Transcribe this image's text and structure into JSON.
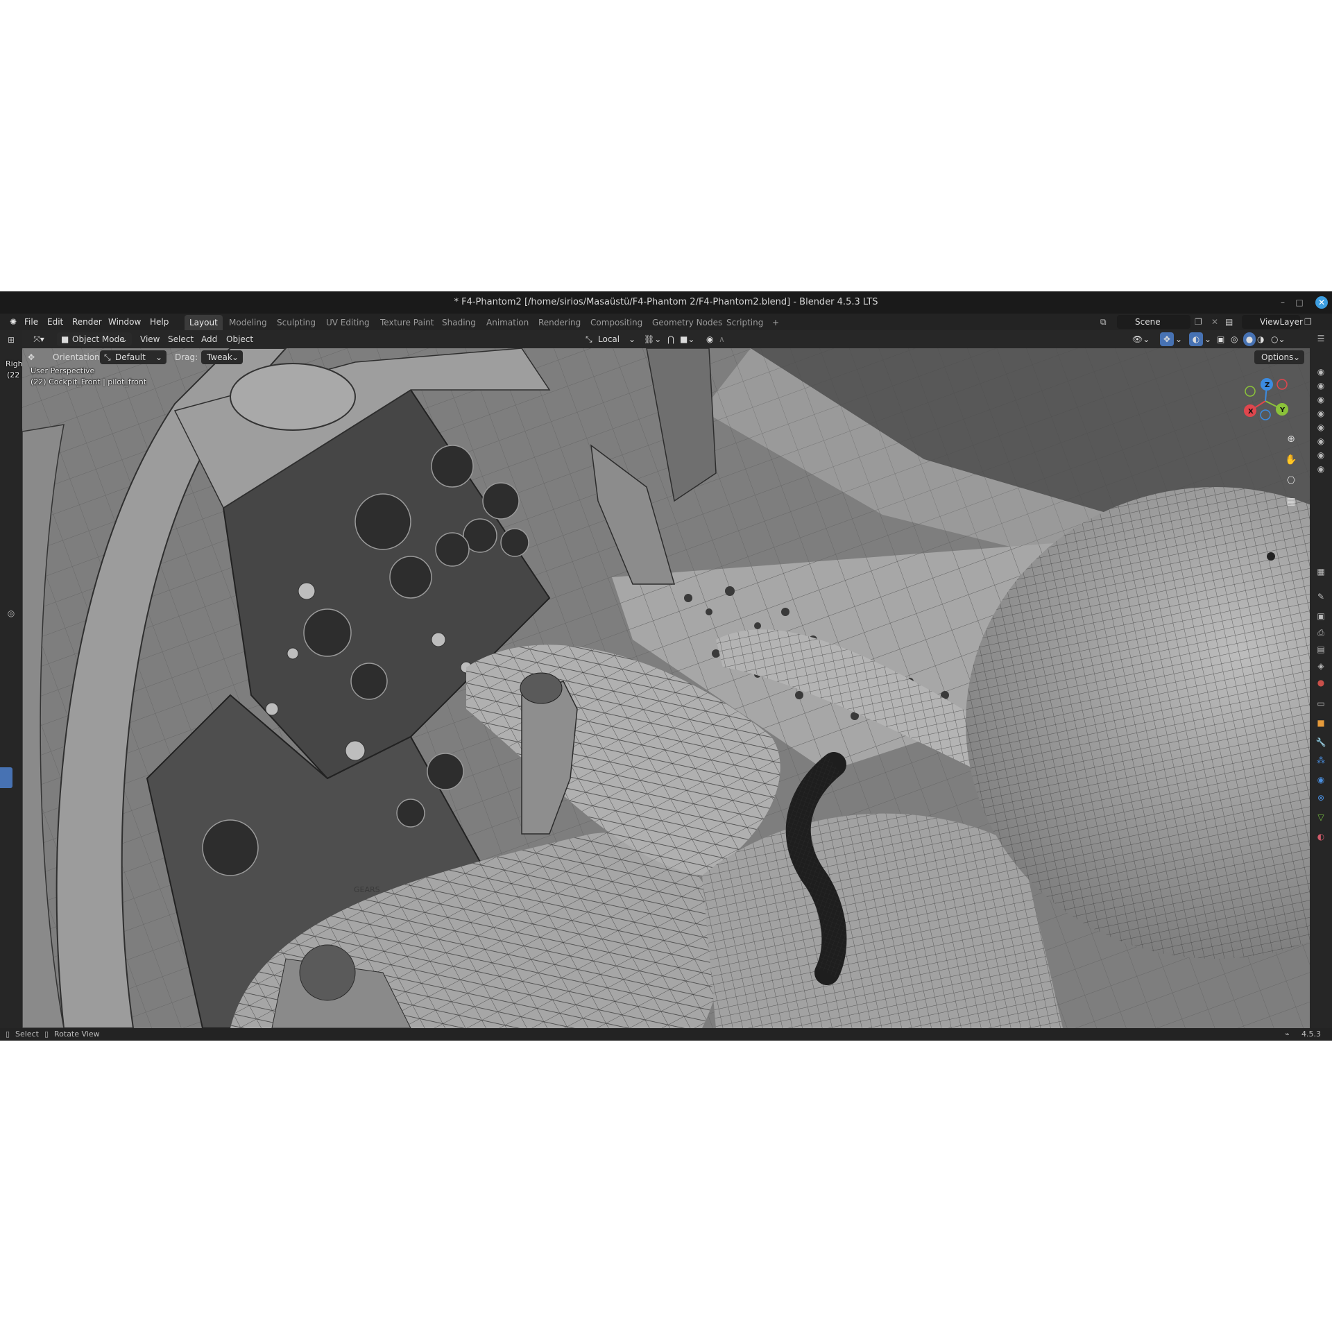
{
  "window": {
    "title": "* F4-Phantom2 [/home/sirios/Masaüstü/F4-Phantom 2/F4-Phantom2.blend] - Blender 4.5.3 LTS",
    "controls": {
      "minimize": "–",
      "maximize": "□",
      "close": "✕"
    }
  },
  "menu": {
    "items": [
      "File",
      "Edit",
      "Render",
      "Window",
      "Help"
    ]
  },
  "workspaces": {
    "tabs": [
      "Layout",
      "Modeling",
      "Sculpting",
      "UV Editing",
      "Texture Paint",
      "Shading",
      "Animation",
      "Rendering",
      "Compositing",
      "Geometry Nodes",
      "Scripting"
    ],
    "active": "Layout",
    "add": "+"
  },
  "scene_field": {
    "value": "Scene"
  },
  "viewlayer_field": {
    "value": "ViewLayer"
  },
  "header": {
    "mode": "Object Mode",
    "menus": [
      "View",
      "Select",
      "Add",
      "Object"
    ],
    "pivot": "Local"
  },
  "toolsettings": {
    "orientation_label": "Orientation:",
    "orientation_value": "Default",
    "drag_label": "Drag:",
    "drag_value": "Tweak",
    "options": "Options"
  },
  "viewport": {
    "perspective": "User Perspective",
    "object_info": "(22) Cockpit_Front | pilot_front",
    "panel_label": "GEARS"
  },
  "gizmo": {
    "x": "X",
    "y": "Y",
    "z": "Z"
  },
  "left_panel": {
    "label_top": "Righ",
    "label_sub": "(22"
  },
  "statusbar": {
    "select": "Select",
    "rotate": "Rotate View",
    "version": "4.5.3"
  },
  "colors": {
    "accent": "#4772b3",
    "axis_x": "#e0464d",
    "axis_y": "#8bc23a",
    "axis_z": "#3c8be0"
  }
}
